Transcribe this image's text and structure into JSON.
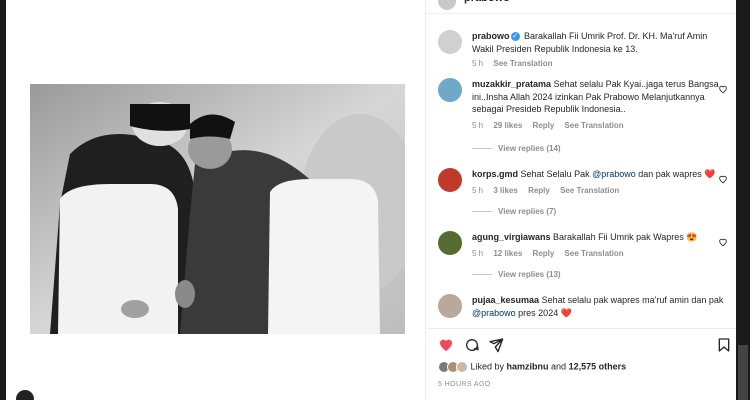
{
  "header": {
    "username": "prabowo"
  },
  "caption": {
    "username": "prabowo",
    "text": "Barakallah Fii Umrik Prof. Dr. KH. Ma'ruf Amin Wakil Presiden Republik Indonesia ke 13.",
    "time": "5 h",
    "see_translation": "See Translation"
  },
  "comments": [
    {
      "username": "muzakkir_pratama",
      "text": "Sehat selalu Pak Kyai..jaga terus Bangsa ini..Insha Allah 2024 izinkan Pak Prabowo Melanjutkannya sebagai Presideb Republik Indonesia..",
      "time": "5 h",
      "likes": "29 likes",
      "reply": "Reply",
      "see_translation": "See Translation",
      "view_replies": "View replies (14)",
      "avatar_color": "#6fa8c8"
    },
    {
      "username": "korps.gmd",
      "text_before": "Sehat Selalu Pak ",
      "mention": "@prabowo",
      "text_after": " dan pak wapres ❤️",
      "time": "5 h",
      "likes": "3 likes",
      "reply": "Reply",
      "see_translation": "See Translation",
      "view_replies": "View replies (7)",
      "avatar_color": "#c0392b"
    },
    {
      "username": "agung_virgiawans",
      "text": "Barakallah Fii Umrik pak Wapres 😍",
      "time": "5 h",
      "likes": "12 likes",
      "reply": "Reply",
      "see_translation": "See Translation",
      "view_replies": "View replies (13)",
      "avatar_color": "#556b2f"
    },
    {
      "username": "pujaa_kesumaa",
      "text_before": "Sehat selalu pak wapres ma'ruf amin dan pak ",
      "mention": "@prabowo",
      "text_after": " pres 2024 ❤️",
      "avatar_color": "#b8a99a"
    }
  ],
  "liked_by": {
    "prefix": "Liked by ",
    "user": "hamzibnu",
    "middle": " and ",
    "others": "12,575 others"
  },
  "posted_ago": "5 HOURS AGO",
  "colors": {
    "like_red": "#ed4956",
    "link": "#00376b",
    "muted": "#8e8e8e"
  },
  "icons": [
    "heart-icon",
    "comment-icon",
    "share-icon",
    "bookmark-icon",
    "verified-icon"
  ]
}
